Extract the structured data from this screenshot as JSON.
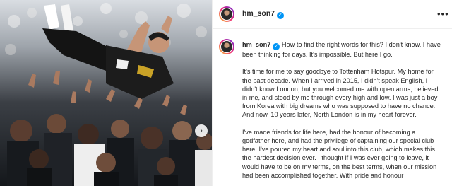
{
  "post": {
    "username": "hm_son7",
    "verified_glyph": "✓",
    "more_glyph": "•••",
    "next_glyph": "›"
  },
  "caption": {
    "paragraphs": [
      "How to find the right words for this? I don't know. I have been thinking for days. It's impossible. But here I go.",
      "It's time for me to say goodbye to Tottenham Hotspur. My home for the past decade. When I arrived in 2015, I didn't speak English, I didn't know London, but you welcomed me with open arms, believed in me, and stood by me through every high and low. I was just a boy from Korea with big dreams who was supposed to have no chance. And now, 10 years later, North London is in my heart forever.",
      "I've made friends for life here, had the honour of becoming a godfather here, and had the privilege of captaining our special club here. I've poured my heart and soul into this club, which makes this the hardest decision ever. I thought if I was ever going to leave, it would have to be on my terms, on the best terms, when our mission had been accomplished together. With pride and honour"
    ]
  },
  "icons": {
    "avatar": "profile-avatar",
    "verified": "verified-badge-icon",
    "more": "more-options-icon",
    "next": "chevron-right-icon"
  }
}
